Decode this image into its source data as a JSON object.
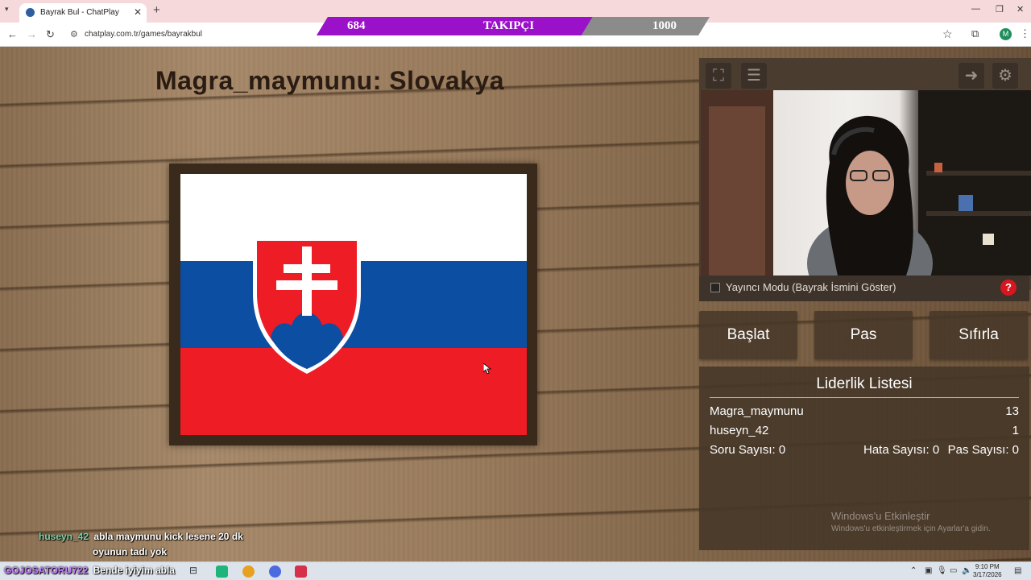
{
  "browser": {
    "tab_title": "Bayrak Bul - ChatPlay",
    "close_symbol": "✕",
    "new_tab_symbol": "+",
    "url": "chatplay.com.tr/games/bayrakbul",
    "profile_initial": "M"
  },
  "follower_bar": {
    "current": "684",
    "label": "TAKIPÇI",
    "goal": "1000",
    "progress": 0.684,
    "fill_color": "#9b10c9"
  },
  "game": {
    "title": "Magra_maymunu: Slovakya",
    "flag_colors": {
      "white": "#ffffff",
      "blue": "#0b4ea2",
      "red": "#ee1c25"
    }
  },
  "panel": {
    "streamer_mode_label": "Yayıncı Modu (Bayrak İsmini Göster)",
    "help_symbol": "?",
    "buttons": {
      "start": "Başlat",
      "pass": "Pas",
      "reset": "Sıfırla"
    },
    "leaderboard": {
      "title": "Liderlik Listesi",
      "rows": [
        {
          "name": "Magra_maymunu",
          "score": "13"
        },
        {
          "name": "huseyn_42",
          "score": "1"
        }
      ],
      "stats": {
        "questions": "Soru Sayısı: 0",
        "errors": "Hata Sayısı: 0",
        "passes": "Pas Sayısı: 0"
      }
    },
    "windows_watermark": {
      "title": "Windows'u Etkinleştir",
      "subtitle": "Windows'u etkinleştirmek için Ayarlar'a gidin."
    }
  },
  "chat": [
    {
      "user": "huseyn_42",
      "message": "abla maymunu kick lesene 20 dk",
      "message2": "oyunun tadı yok",
      "user_color": "#7ed3a8"
    },
    {
      "user": "GOJOSATORU722",
      "message": "Bende iyiyim abla",
      "user_color": "#c27bff"
    }
  ],
  "taskbar": {
    "time": "9:10 PM",
    "date": "3/17/2026"
  }
}
